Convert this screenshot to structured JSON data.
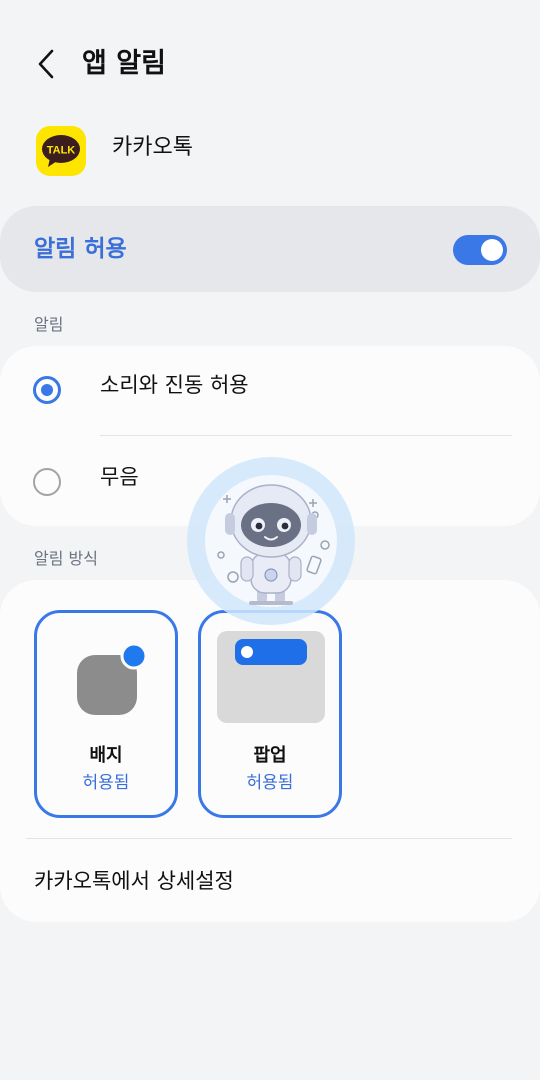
{
  "header": {
    "title": "앱 알림",
    "back_icon": "chevron-left-icon"
  },
  "app": {
    "name": "카카오톡",
    "icon_label": "TALK",
    "icon_color": "#fee500"
  },
  "allow": {
    "label": "알림 허용",
    "enabled": true,
    "accent": "#3a78e8"
  },
  "alerts": {
    "section_label": "알림",
    "options": [
      {
        "label": "소리와 진동 허용",
        "selected": true
      },
      {
        "label": "무음",
        "selected": false
      }
    ]
  },
  "style": {
    "section_label": "알림 방식",
    "cards": [
      {
        "name": "배지",
        "status": "허용됨"
      },
      {
        "name": "팝업",
        "status": "허용됨"
      }
    ]
  },
  "detail": {
    "label": "카카오톡에서 상세설정"
  }
}
